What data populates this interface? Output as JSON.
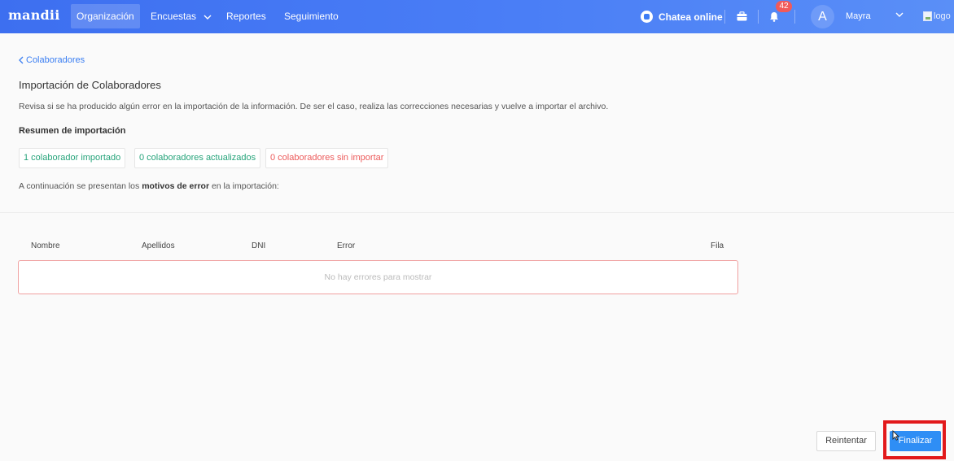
{
  "app": {
    "brand": "mandii"
  },
  "nav": {
    "items": [
      {
        "label": "Organización",
        "active": true
      },
      {
        "label": "Encuestas",
        "dropdown": true
      },
      {
        "label": "Reportes"
      },
      {
        "label": "Seguimiento"
      }
    ]
  },
  "header": {
    "chat_label": "Chatea online",
    "notifications_count": "42",
    "avatar_initial": "A",
    "user_name": "Mayra",
    "logo_alt": "logo"
  },
  "page": {
    "back_link": "Colaboradores",
    "title": "Importación de Colaboradores",
    "description": "Revisa si se ha producido algún error en la importación de la información. De ser el caso, realiza las correcciones necesarias y vuelve a importar el archivo.",
    "summary_title": "Resumen de importación",
    "stats": {
      "imported": "1 colaborador importado",
      "updated": "0 colaboradores actualizados",
      "not_imported": "0 colaboradores sin importar"
    },
    "note_prefix": "A continuación se presentan los ",
    "note_bold": "motivos de error",
    "note_suffix": " en la importación:"
  },
  "table": {
    "columns": {
      "nombre": "Nombre",
      "apellidos": "Apellidos",
      "dni": "DNI",
      "error": "Error",
      "fila": "Fila"
    },
    "empty_message": "No hay errores para mostrar"
  },
  "actions": {
    "retry": "Reintentar",
    "finish": "Finalizar"
  },
  "colors": {
    "nav": "#4a7ef6",
    "primary": "#2f8ef5",
    "success": "#27a47b",
    "danger": "#ec5b5b",
    "highlight": "#e2191b"
  }
}
